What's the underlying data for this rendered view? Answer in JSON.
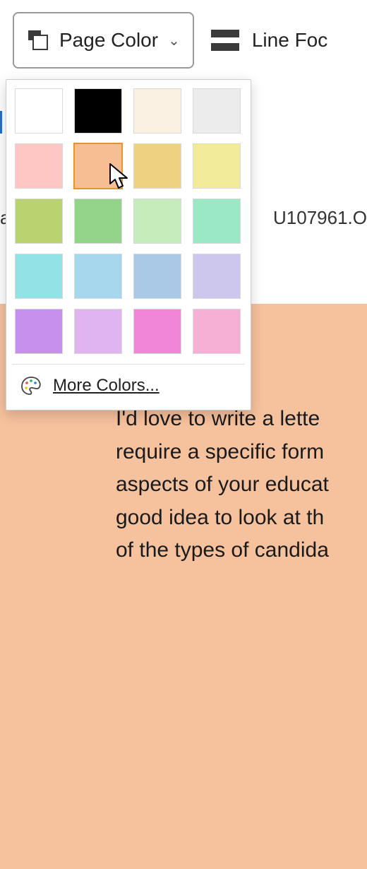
{
  "toolbar": {
    "page_color_label": "Page Color",
    "line_focus_label": "Line Foc"
  },
  "dropdown": {
    "swatches": [
      "#ffffff",
      "#000000",
      "#fbf1e3",
      "#ececec",
      "#fec7c3",
      "#f7be93",
      "#eed282",
      "#f1eb9a",
      "#b8d370",
      "#94d48a",
      "#c7ecbb",
      "#9be8c5",
      "#92e3e6",
      "#a6d7ed",
      "#a9c9e6",
      "#cdc6ed",
      "#c790ec",
      "#e0b4ee",
      "#f186d8",
      "#f7b0d5"
    ],
    "selected_index": 5,
    "more_colors_label": "More Colors..."
  },
  "editor": {
    "filename_left": "a",
    "filename_right": "U107961.O",
    "body_text": "I'd love to write a lette\nrequire a specific form\naspects of your educat\ngood idea to look at th\nof the types of candida"
  }
}
